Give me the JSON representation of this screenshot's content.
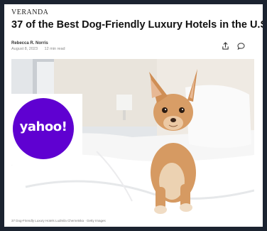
{
  "article": {
    "publication": "VERANDA",
    "headline": "37 of the Best Dog-Friendly Luxury Hotels in the U.S.",
    "author": "Rebecca R. Norris",
    "date": "August 8, 2023",
    "read_time": "12 min read",
    "caption": "37 Dog-Friendly Luxury Hotels Ludmila Chernetska · Getty Images"
  },
  "badge": {
    "logo_text": "yahoo!",
    "color": "#5f01d1"
  },
  "icons": {
    "share": "share-icon",
    "comment": "comment-icon"
  }
}
